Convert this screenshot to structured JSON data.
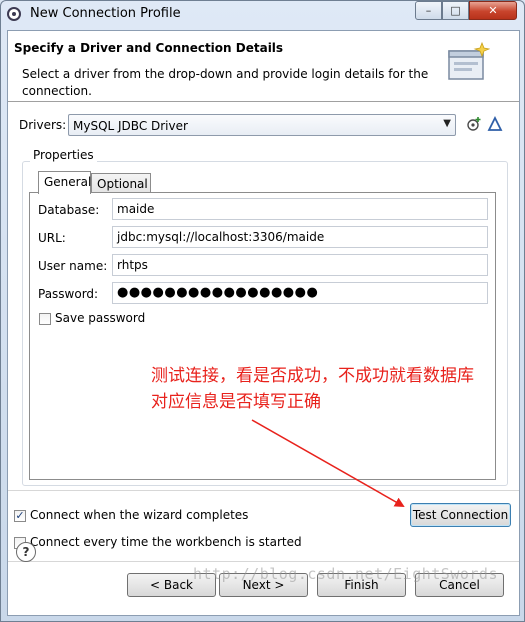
{
  "window": {
    "title": "New Connection Profile",
    "controls": {
      "minimize": "–",
      "maximize": "□",
      "close": "✕"
    }
  },
  "banner": {
    "title": "Specify a Driver and Connection Details",
    "description": "Select a driver from the drop-down and provide login details for the connection."
  },
  "drivers": {
    "label": "Drivers:",
    "selected": "MySQL JDBC Driver",
    "new_icon": "new-driver-icon",
    "edit_icon": "edit-driver-icon"
  },
  "properties": {
    "group_label": "Properties",
    "tabs": [
      {
        "label": "General",
        "active": true
      },
      {
        "label": "Optional",
        "active": false
      }
    ],
    "fields": [
      {
        "label": "Database:",
        "value": "maide"
      },
      {
        "label": "URL:",
        "value": "jdbc:mysql://localhost:3306/maide"
      },
      {
        "label": "User name:",
        "value": "rhtps"
      },
      {
        "label": "Password:",
        "value": "●●●●●●●●●●●●●●●●●"
      }
    ],
    "save_password": {
      "label": "Save password",
      "checked": false
    }
  },
  "annotation": {
    "lines": [
      "测试连接，看是否成功，不成功就看数据库",
      "对应信息是否填写正确"
    ],
    "color": "#e8221c"
  },
  "options": {
    "connect_on_finish": {
      "label": "Connect when the wizard completes",
      "checked": true
    },
    "connect_on_startup": {
      "label": "Connect every time the workbench is started",
      "checked": false
    }
  },
  "buttons": {
    "test_connection": "Test Connection",
    "back": "< Back",
    "next": "Next >",
    "finish": "Finish",
    "cancel": "Cancel"
  },
  "watermark": "http://blog.csdn.net/EightSwords"
}
